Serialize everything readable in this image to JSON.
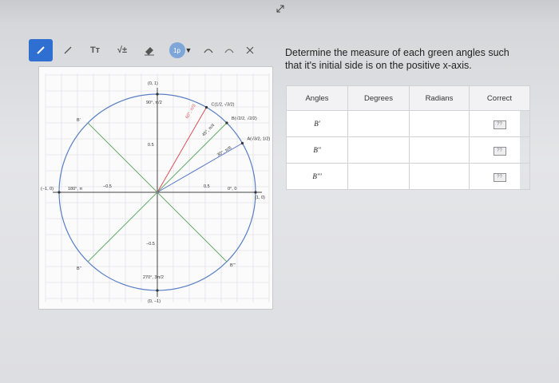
{
  "toolbar": {
    "tools": [
      {
        "name": "pencil-tool",
        "active": true
      },
      {
        "name": "line-tool",
        "active": false
      },
      {
        "name": "text-tool",
        "label": "Tт"
      },
      {
        "name": "math-tool",
        "label": "√±"
      },
      {
        "name": "eraser-tool"
      }
    ],
    "color_dot_label": "1p",
    "accent": "#2f6fd1"
  },
  "question": {
    "text": "Determine the measure of each green angles such that it's initial side is on the positive x-axis."
  },
  "table": {
    "headers": [
      "Angles",
      "Degrees",
      "Radians",
      "Correct"
    ],
    "rows": [
      {
        "angle": "B'",
        "degrees": "",
        "radians": "",
        "correct_icon": "??"
      },
      {
        "angle": "B''",
        "degrees": "",
        "radians": "",
        "correct_icon": "??"
      },
      {
        "angle": "B'''",
        "degrees": "",
        "radians": "",
        "correct_icon": "??"
      }
    ]
  },
  "unit_circle": {
    "labels": {
      "top_point": "(0, 1)",
      "deg90": "90°, π/2",
      "left_point": "(−1, 0)",
      "deg180": "180°, π",
      "right_point": "(1, 0)",
      "deg0": "0°, 0",
      "bottom_point": "(0, −1)",
      "deg270": "270°, 3π/2",
      "pt60": "C(1/2, √3/2)",
      "pt45": "B(√2/2, √2/2)",
      "pt30": "A(√3/2, 1/2)",
      "deg60": "60°, π/3",
      "deg45": "45°, π/4",
      "deg30": "30°, π/6",
      "b1": "B'",
      "b2": "B''",
      "b3": "B'''",
      "half_pos": "0.5",
      "half_neg": "−0.5"
    },
    "colors": {
      "circle": "#5a7fc4",
      "green": "#6aa86a",
      "red": "#d9505a",
      "blue": "#5577c9",
      "axis": "#444"
    }
  }
}
